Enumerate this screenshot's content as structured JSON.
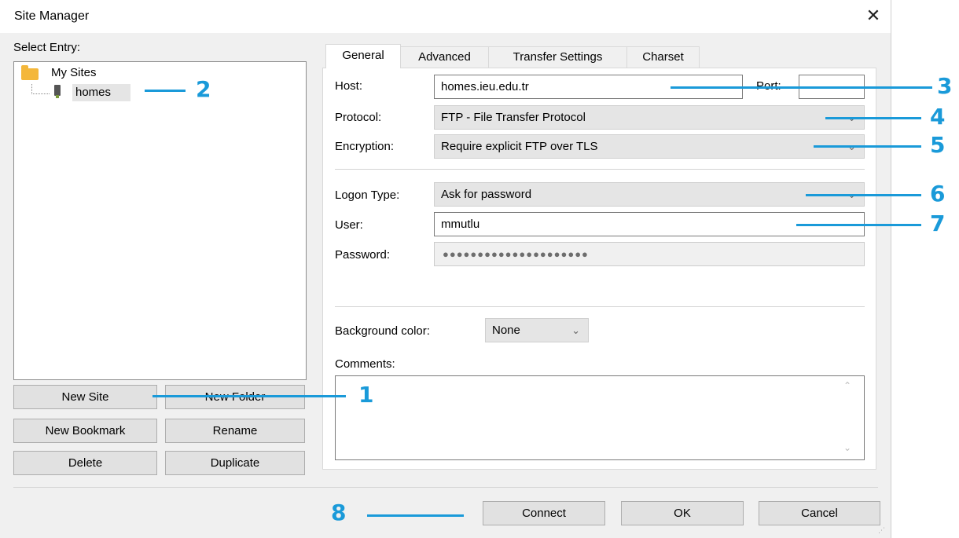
{
  "window": {
    "title": "Site Manager",
    "close_glyph": "✕"
  },
  "left": {
    "select_entry_label": "Select Entry:",
    "tree": {
      "root": "My Sites",
      "child": "homes"
    },
    "buttons": {
      "new_site": "New Site",
      "new_folder": "New Folder",
      "new_bookmark": "New Bookmark",
      "rename": "Rename",
      "delete": "Delete",
      "duplicate": "Duplicate"
    }
  },
  "tabs": [
    {
      "label": "General",
      "active": true
    },
    {
      "label": "Advanced"
    },
    {
      "label": "Transfer Settings"
    },
    {
      "label": "Charset"
    }
  ],
  "general": {
    "host_label": "Host:",
    "host_value": "homes.ieu.edu.tr",
    "port_label": "Port:",
    "port_value": "",
    "protocol_label": "Protocol:",
    "protocol_value": "FTP - File Transfer Protocol",
    "encryption_label": "Encryption:",
    "encryption_value": "Require explicit FTP over TLS",
    "logon_type_label": "Logon Type:",
    "logon_type_value": "Ask for password",
    "user_label": "User:",
    "user_value": "mmutlu",
    "password_label": "Password:",
    "password_value": "●●●●●●●●●●●●●●●●●●●●●",
    "bg_color_label": "Background color:",
    "bg_color_value": "None",
    "comments_label": "Comments:",
    "comments_value": ""
  },
  "footer": {
    "connect": "Connect",
    "ok": "OK",
    "cancel": "Cancel"
  },
  "callouts": [
    "1",
    "2",
    "3",
    "4",
    "5",
    "6",
    "7",
    "8"
  ],
  "colors": {
    "callout": "#1a9ad9",
    "folder": "#f4b73a",
    "dialog_bg": "#f0f0f0"
  }
}
